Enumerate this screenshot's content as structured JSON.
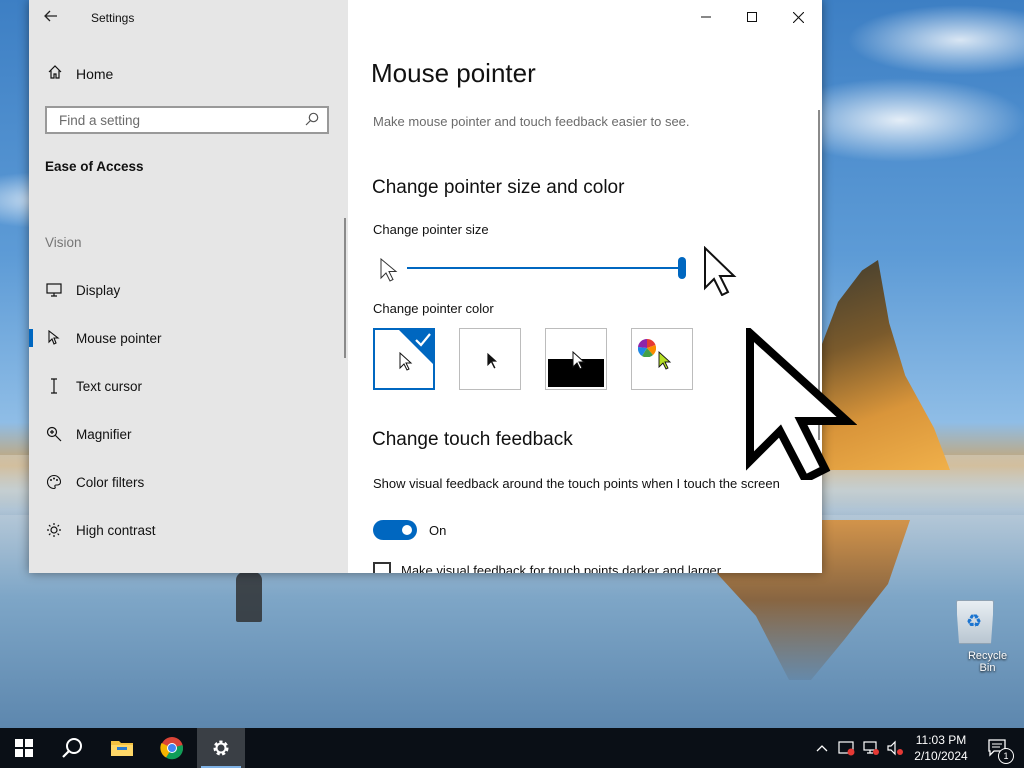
{
  "window": {
    "app_title": "Settings",
    "minimize": "—",
    "maximize": "☐",
    "close": "✕"
  },
  "sidebar": {
    "home_label": "Home",
    "search_placeholder": "Find a setting",
    "section_title": "Ease of Access",
    "group_label": "Vision",
    "items": [
      {
        "label": "Display",
        "icon": "display-icon"
      },
      {
        "label": "Mouse pointer",
        "icon": "mouse-pointer-icon",
        "active": true
      },
      {
        "label": "Text cursor",
        "icon": "text-cursor-icon"
      },
      {
        "label": "Magnifier",
        "icon": "magnifier-icon"
      },
      {
        "label": "Color filters",
        "icon": "color-filters-icon"
      },
      {
        "label": "High contrast",
        "icon": "high-contrast-icon"
      }
    ]
  },
  "content": {
    "title": "Mouse pointer",
    "description": "Make mouse pointer and touch feedback easier to see.",
    "section1_heading": "Change pointer size and color",
    "size_label": "Change pointer size",
    "size_level": 1.0,
    "color_label": "Change pointer color",
    "color_options": [
      {
        "name": "white",
        "selected": true
      },
      {
        "name": "black",
        "selected": false
      },
      {
        "name": "inverted",
        "selected": false
      },
      {
        "name": "custom",
        "selected": false
      }
    ],
    "section2_heading": "Change touch feedback",
    "touch_desc": "Show visual feedback around the touch points when I touch the screen",
    "toggle_state": "On",
    "checkbox_label": "Make visual feedback for touch points darker and larger"
  },
  "desktop": {
    "recycle_bin_label": "Recycle Bin"
  },
  "taskbar": {
    "apps": [
      "start-icon",
      "search-icon",
      "file-explorer-icon",
      "chrome-icon",
      "settings-icon"
    ],
    "time": "11:03 PM",
    "date": "2/10/2024",
    "notification_count": "1"
  },
  "colors": {
    "accent": "#0067c0",
    "sidebar_bg": "#e6e6e6",
    "taskbar_bg": "#0a0f16"
  }
}
